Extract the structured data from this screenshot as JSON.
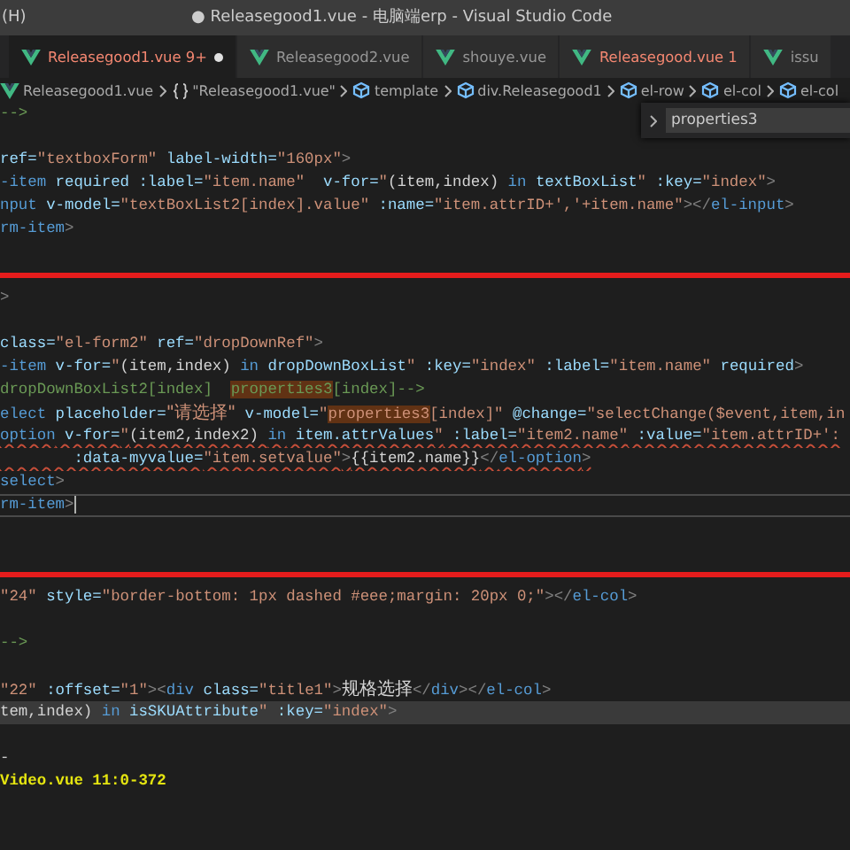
{
  "window": {
    "menu_hint": "(H)",
    "title": "● Releasegood1.vue - 电脑端erp - Visual Studio Code"
  },
  "tabs": [
    {
      "label": "Releasegood1.vue 9+",
      "selected": true,
      "problems": true,
      "modified": true
    },
    {
      "label": "Releasegood2.vue",
      "selected": false,
      "problems": false,
      "modified": false
    },
    {
      "label": "shouye.vue",
      "selected": false,
      "problems": false,
      "modified": false
    },
    {
      "label": "Releasegood.vue 1",
      "selected": false,
      "problems": true,
      "modified": false
    },
    {
      "label": "issu",
      "selected": false,
      "problems": false,
      "modified": false
    }
  ],
  "breadcrumbs": [
    {
      "label": "Releasegood1.vue",
      "kind": "file"
    },
    {
      "label": "\"Releasegood1.vue\"",
      "kind": "object"
    },
    {
      "label": "template",
      "kind": "element"
    },
    {
      "label": "div.Releasegood1",
      "kind": "element"
    },
    {
      "label": "el-row",
      "kind": "element"
    },
    {
      "label": "el-col",
      "kind": "element"
    },
    {
      "label": "el-col",
      "kind": "element"
    }
  ],
  "find_widget": {
    "value": "properties3"
  },
  "editor_rows": [
    {
      "kind": "code",
      "error": false,
      "current": false,
      "tokens": [
        {
          "text": "-->",
          "kind": "comment"
        }
      ]
    },
    {
      "kind": "blank"
    },
    {
      "kind": "code",
      "error": false,
      "current": false,
      "tokens": [
        {
          "text": "ref=",
          "kind": "attr"
        },
        {
          "text": "\"textboxForm\"",
          "kind": "string"
        },
        {
          "text": " label-width=",
          "kind": "attr"
        },
        {
          "text": "\"160px\"",
          "kind": "string"
        },
        {
          "text": ">",
          "kind": "punct"
        }
      ]
    },
    {
      "kind": "code",
      "error": false,
      "current": false,
      "tokens": [
        {
          "text": "-item",
          "kind": "tag"
        },
        {
          "text": " required :label=",
          "kind": "attr"
        },
        {
          "text": "\"item.name\"",
          "kind": "string"
        },
        {
          "text": "  v-for=",
          "kind": "attr"
        },
        {
          "text": "\"",
          "kind": "string"
        },
        {
          "text": "(item,index) ",
          "kind": "text"
        },
        {
          "text": "in",
          "kind": "keyword"
        },
        {
          "text": " textBoxList",
          "kind": "attr"
        },
        {
          "text": "\"",
          "kind": "string"
        },
        {
          "text": " :key=",
          "kind": "attr"
        },
        {
          "text": "\"index\"",
          "kind": "string"
        },
        {
          "text": ">",
          "kind": "punct"
        }
      ]
    },
    {
      "kind": "code",
      "error": false,
      "current": false,
      "tokens": [
        {
          "text": "nput",
          "kind": "tag"
        },
        {
          "text": " v-model=",
          "kind": "attr"
        },
        {
          "text": "\"textBoxList2[index].value\"",
          "kind": "string"
        },
        {
          "text": " :name=",
          "kind": "attr"
        },
        {
          "text": "\"item.attrID+','+item.name\"",
          "kind": "string"
        },
        {
          "text": "></",
          "kind": "punct"
        },
        {
          "text": "el-input",
          "kind": "tag"
        },
        {
          "text": ">",
          "kind": "punct"
        }
      ]
    },
    {
      "kind": "code",
      "error": false,
      "current": false,
      "tokens": [
        {
          "text": "rm-item",
          "kind": "tag"
        },
        {
          "text": ">",
          "kind": "punct"
        }
      ]
    },
    {
      "kind": "blank"
    },
    {
      "kind": "rule"
    },
    {
      "kind": "code",
      "error": false,
      "current": false,
      "tokens": [
        {
          "text": ">",
          "kind": "punct"
        }
      ]
    },
    {
      "kind": "blank"
    },
    {
      "kind": "code",
      "error": false,
      "current": false,
      "tokens": [
        {
          "text": "class=",
          "kind": "attr"
        },
        {
          "text": "\"el-form2\"",
          "kind": "string"
        },
        {
          "text": " ref=",
          "kind": "attr"
        },
        {
          "text": "\"dropDownRef\"",
          "kind": "string"
        },
        {
          "text": ">",
          "kind": "punct"
        }
      ]
    },
    {
      "kind": "code",
      "error": false,
      "current": false,
      "tokens": [
        {
          "text": "-item",
          "kind": "tag"
        },
        {
          "text": " v-for=",
          "kind": "attr"
        },
        {
          "text": "\"",
          "kind": "string"
        },
        {
          "text": "(item,index) ",
          "kind": "text"
        },
        {
          "text": "in",
          "kind": "keyword"
        },
        {
          "text": " dropDownBoxList",
          "kind": "attr"
        },
        {
          "text": "\"",
          "kind": "string"
        },
        {
          "text": " :key=",
          "kind": "attr"
        },
        {
          "text": "\"index\"",
          "kind": "string"
        },
        {
          "text": " :label=",
          "kind": "attr"
        },
        {
          "text": "\"item.name\"",
          "kind": "string"
        },
        {
          "text": " required",
          "kind": "attr"
        },
        {
          "text": ">",
          "kind": "punct"
        }
      ]
    },
    {
      "kind": "code",
      "error": false,
      "current": false,
      "tokens": [
        {
          "text": "dropDownBoxList2[index]  ",
          "kind": "comment"
        },
        {
          "text": "properties3",
          "kind": "comment-match"
        },
        {
          "text": "[index]-->",
          "kind": "comment"
        }
      ]
    },
    {
      "kind": "code",
      "error": false,
      "current": false,
      "tokens": [
        {
          "text": "elect",
          "kind": "tag"
        },
        {
          "text": " placeholder=",
          "kind": "attr"
        },
        {
          "text": "\"请选择\"",
          "kind": "string"
        },
        {
          "text": " v-model=",
          "kind": "attr"
        },
        {
          "text": "\"",
          "kind": "string"
        },
        {
          "text": "properties3",
          "kind": "string-match"
        },
        {
          "text": "[index]\"",
          "kind": "string"
        },
        {
          "text": " @change=",
          "kind": "attr"
        },
        {
          "text": "\"selectChange($event,item,in",
          "kind": "string"
        }
      ]
    },
    {
      "kind": "code",
      "error": true,
      "current": false,
      "tokens": [
        {
          "text": "option",
          "kind": "tag"
        },
        {
          "text": " v-for=",
          "kind": "attr"
        },
        {
          "text": "\"",
          "kind": "string"
        },
        {
          "text": "(item2,index2) ",
          "kind": "text"
        },
        {
          "text": "in",
          "kind": "keyword"
        },
        {
          "text": " item.attrValues",
          "kind": "attr"
        },
        {
          "text": "\"",
          "kind": "string"
        },
        {
          "text": " :label=",
          "kind": "attr"
        },
        {
          "text": "\"item2.name\"",
          "kind": "string"
        },
        {
          "text": " :value=",
          "kind": "attr"
        },
        {
          "text": "\"item.attrID+':",
          "kind": "string"
        }
      ]
    },
    {
      "kind": "code",
      "error": true,
      "current": false,
      "tokens": [
        {
          "text": "        :data-myvalue=",
          "kind": "attr"
        },
        {
          "text": "\"item.setvalue\"",
          "kind": "string"
        },
        {
          "text": ">",
          "kind": "punct"
        },
        {
          "text": "{{item2.name}}",
          "kind": "text"
        },
        {
          "text": "</",
          "kind": "punct"
        },
        {
          "text": "el-option",
          "kind": "tag"
        },
        {
          "text": ">",
          "kind": "punct"
        }
      ]
    },
    {
      "kind": "code",
      "error": false,
      "current": false,
      "tokens": [
        {
          "text": "select",
          "kind": "tag"
        },
        {
          "text": ">",
          "kind": "punct"
        }
      ]
    },
    {
      "kind": "code",
      "error": false,
      "current": true,
      "tokens": [
        {
          "text": "rm-item",
          "kind": "tag"
        },
        {
          "text": ">",
          "kind": "punct"
        }
      ]
    },
    {
      "kind": "blank"
    },
    {
      "kind": "blank"
    },
    {
      "kind": "rule"
    },
    {
      "kind": "code",
      "error": false,
      "current": false,
      "tokens": [
        {
          "text": "\"24\"",
          "kind": "string"
        },
        {
          "text": " style=",
          "kind": "attr"
        },
        {
          "text": "\"border-bottom: 1px dashed #eee;margin: 20px 0;\"",
          "kind": "string"
        },
        {
          "text": "></",
          "kind": "punct"
        },
        {
          "text": "el-col",
          "kind": "tag"
        },
        {
          "text": ">",
          "kind": "punct"
        }
      ]
    },
    {
      "kind": "blank"
    },
    {
      "kind": "code",
      "error": false,
      "current": false,
      "tokens": [
        {
          "text": "-->",
          "kind": "comment"
        }
      ]
    },
    {
      "kind": "blank"
    },
    {
      "kind": "code",
      "error": false,
      "current": false,
      "tokens": [
        {
          "text": "\"22\"",
          "kind": "string"
        },
        {
          "text": " :offset=",
          "kind": "attr"
        },
        {
          "text": "\"1\"",
          "kind": "string"
        },
        {
          "text": "><",
          "kind": "punct"
        },
        {
          "text": "div",
          "kind": "tag"
        },
        {
          "text": " class=",
          "kind": "attr"
        },
        {
          "text": "\"title1\"",
          "kind": "string"
        },
        {
          "text": ">",
          "kind": "punct"
        },
        {
          "text": "规格选择",
          "kind": "text"
        },
        {
          "text": "</",
          "kind": "punct"
        },
        {
          "text": "div",
          "kind": "tag"
        },
        {
          "text": "></",
          "kind": "punct"
        },
        {
          "text": "el-col",
          "kind": "tag"
        },
        {
          "text": ">",
          "kind": "punct"
        }
      ]
    },
    {
      "kind": "sticky",
      "error": false,
      "current": false,
      "tokens": [
        {
          "text": "tem,index) ",
          "kind": "text"
        },
        {
          "text": "in",
          "kind": "keyword"
        },
        {
          "text": " isSKUAttribute",
          "kind": "attr"
        },
        {
          "text": "\"",
          "kind": "string"
        },
        {
          "text": " :key=",
          "kind": "attr"
        },
        {
          "text": "\"index\"",
          "kind": "string"
        },
        {
          "text": ">",
          "kind": "punct"
        }
      ]
    }
  ],
  "terminal_rows": [
    {
      "kind": "blank"
    },
    {
      "kind": "plain",
      "text": "-"
    },
    {
      "kind": "highlight",
      "text": "Video.vue 11:0-372"
    },
    {
      "kind": "blank"
    },
    {
      "kind": "blank"
    }
  ]
}
